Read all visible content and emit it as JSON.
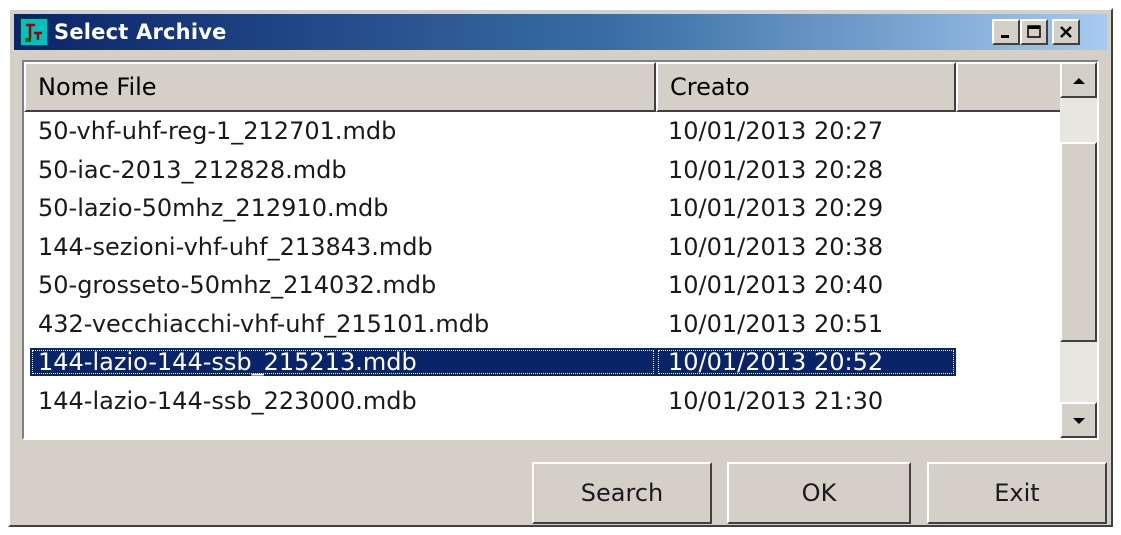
{
  "window": {
    "title": "Select Archive",
    "icon": "app-icon",
    "controls": [
      "minimize-icon",
      "maximize-icon",
      "close-icon"
    ]
  },
  "list": {
    "columns": [
      "Nome File",
      "Creato",
      ""
    ],
    "rows": [
      {
        "name": "50-vhf-uhf-reg-1_212701.mdb",
        "created": "10/01/2013 20:27"
      },
      {
        "name": "50-iac-2013_212828.mdb",
        "created": "10/01/2013 20:28"
      },
      {
        "name": "50-lazio-50mhz_212910.mdb",
        "created": "10/01/2013 20:29"
      },
      {
        "name": "144-sezioni-vhf-uhf_213843.mdb",
        "created": "10/01/2013 20:38"
      },
      {
        "name": "50-grosseto-50mhz_214032.mdb",
        "created": "10/01/2013 20:40"
      },
      {
        "name": "432-vecchiacchi-vhf-uhf_215101.mdb",
        "created": "10/01/2013 20:51"
      },
      {
        "name": "144-lazio-144-ssb_215213.mdb",
        "created": "10/01/2013 20:52"
      },
      {
        "name": "144-lazio-144-ssb_223000.mdb",
        "created": "10/01/2013 21:30"
      }
    ],
    "selected_index": 6
  },
  "buttons": {
    "search": "Search",
    "ok": "OK",
    "exit": "Exit"
  },
  "colors": {
    "selection": "#0a246a",
    "face": "#d4d0c8"
  }
}
